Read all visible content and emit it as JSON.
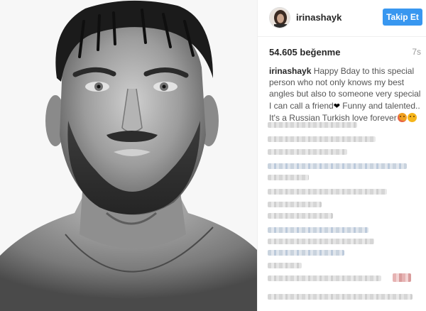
{
  "post": {
    "image_alt": "Black and white close-up portrait of a bearded man"
  },
  "header": {
    "username": "irinashayk",
    "follow_label": "Takip Et"
  },
  "stats": {
    "likes": "54.605 beğenme",
    "time_ago": "7s"
  },
  "caption": {
    "username": "irinashayk",
    "text": "Happy Bday to this special person who not only knows my best angles but also to someone very special I can call a friend",
    "heart": "❤",
    "text2": " Funny and talented.. It's a Russian Turkish love forever"
  },
  "comments": {
    "note": "",
    "rows": 14
  },
  "colors": {
    "follow_button": "#3897f0",
    "username": "#262626",
    "timestamp": "#999999"
  }
}
